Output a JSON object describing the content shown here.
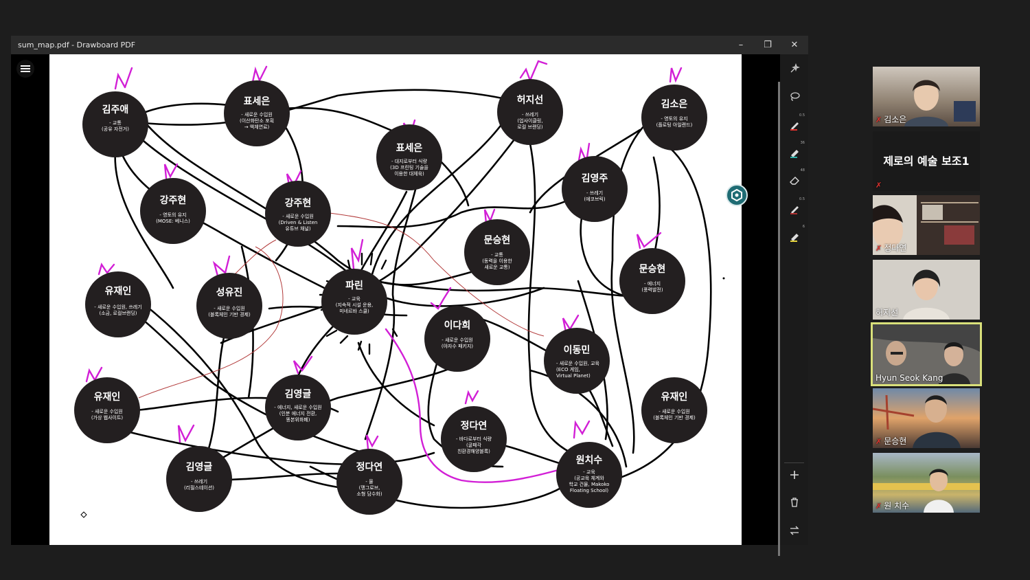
{
  "window": {
    "title": "sum_map.pdf - Drawboard PDF",
    "minimize": "–",
    "maximize": "❐",
    "close": "✕"
  },
  "nodes": [
    {
      "name": "김주애",
      "desc": "- 교통\n(공유 자전거)"
    },
    {
      "name": "표세은",
      "desc": "- 새로운 수입원\n(이산화탄소 포획\n→ 액체연료)"
    },
    {
      "name": "허지선",
      "desc": "- 쓰레기\n(업사이클링,\n로컬 브랜딩)"
    },
    {
      "name": "김소은",
      "desc": "- 영토의 유지\n(플로팅 아일랜드)"
    },
    {
      "name": "표세은",
      "desc": "- 대지로부터 식량\n(3D 프린팅 기술을\n이용한 대체육)"
    },
    {
      "name": "강주현",
      "desc": "- 영토의 유지\n(MOSE: 베니스)"
    },
    {
      "name": "강주현",
      "desc": "- 새로운 수입원\n(Driven & Listen\n유튜브 채널)"
    },
    {
      "name": "김영주",
      "desc": "- 쓰레기\n(에코브릭)"
    },
    {
      "name": "문승현",
      "desc": "- 교통\n(동력을 이용한\n새로운 교통)"
    },
    {
      "name": "문승현",
      "desc": "- 에너지\n(풍력발전)"
    },
    {
      "name": "유재인",
      "desc": "- 새로운 수입원, 쓰레기\n(소금, 로컬브랜딩)"
    },
    {
      "name": "성유진",
      "desc": "- 새로운 수입원\n(블록체인 기반 경제)"
    },
    {
      "name": "파린",
      "desc": "- 교육\n(지속적 시설 운용,\n미네르바 스쿨)"
    },
    {
      "name": "이다희",
      "desc": "- 새로운 수입원\n(야자수 패키지)"
    },
    {
      "name": "이동민",
      "desc": "- 새로운 수입원, 교육\n(ECO 게임,\nVirtual Planet)"
    },
    {
      "name": "유재인",
      "desc": "- 새로운 수입원\n(가상 웹사이트)"
    },
    {
      "name": "김영글",
      "desc": "- 에너지, 새로운 수입원\n(인분 에너지 전환,\n똥본위화폐)"
    },
    {
      "name": "정다연",
      "desc": "- 바다로부터 식량\n(굴패각\n친환경해양블록)"
    },
    {
      "name": "유재인",
      "desc": "- 새로운 수입원\n(블록체인 기반 경제)"
    },
    {
      "name": "김영글",
      "desc": "- 쓰레기\n(리필스테이션)"
    },
    {
      "name": "정다연",
      "desc": "- 물\n(맹그로브,\n소형 담수화)"
    },
    {
      "name": "원치수",
      "desc": "- 교육\n(공교육 체계와\n학교 건물, Makoko\nFloating School)"
    }
  ],
  "tools": [
    {
      "icon": "magic-select-icon",
      "num": ""
    },
    {
      "icon": "lasso-icon",
      "num": ""
    },
    {
      "icon": "pen-red-icon",
      "num": "0.5"
    },
    {
      "icon": "highlighter-teal-icon",
      "num": "36"
    },
    {
      "icon": "eraser-icon",
      "num": "48"
    },
    {
      "icon": "pen-dark-icon",
      "num": "0.5"
    },
    {
      "icon": "highlighter-yellow-icon",
      "num": "6"
    }
  ],
  "participants": [
    {
      "name": "김소은",
      "muted": true
    },
    {
      "name": "제로의 예술 보조1",
      "muted": true
    },
    {
      "name": "정다연",
      "muted": true
    },
    {
      "name": "허지선",
      "muted": false
    },
    {
      "name": "Hyun Seok Kang",
      "muted": false,
      "active": true
    },
    {
      "name": "문승현",
      "muted": true
    },
    {
      "name": "원 치수",
      "muted": true
    }
  ],
  "colors": {
    "accent_highlight": "#d9e07a",
    "muted_mic": "#e0332f",
    "ink": "#000000",
    "magenta": "#d21fd6",
    "red_line": "#b23a3a"
  }
}
